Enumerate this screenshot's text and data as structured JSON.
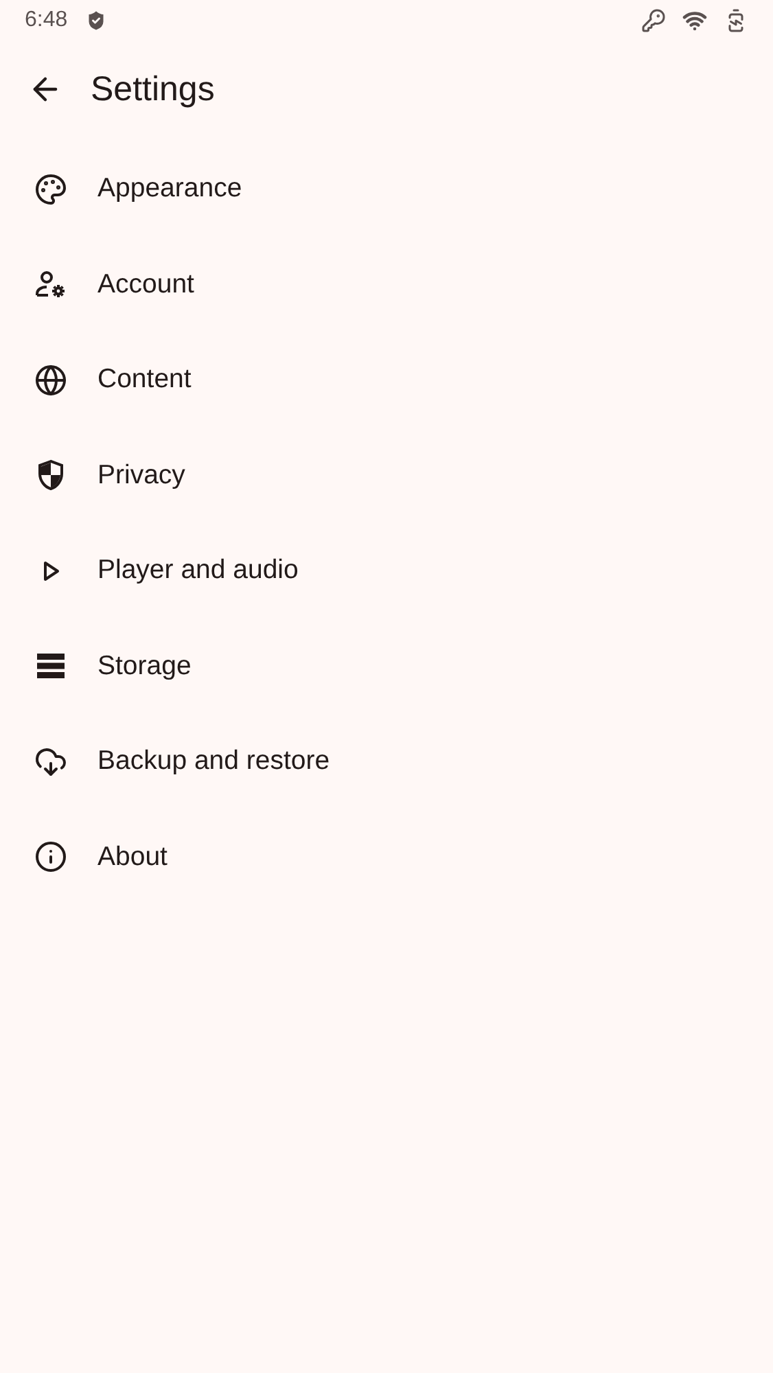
{
  "status_bar": {
    "time": "6:48"
  },
  "header": {
    "title": "Settings"
  },
  "items": [
    {
      "label": "Appearance",
      "kind": "palette"
    },
    {
      "label": "Account",
      "kind": "usergear"
    },
    {
      "label": "Content",
      "kind": "globe"
    },
    {
      "label": "Privacy",
      "kind": "shield"
    },
    {
      "label": "Player and audio",
      "kind": "play"
    },
    {
      "label": "Storage",
      "kind": "storage"
    },
    {
      "label": "Backup and restore",
      "kind": "cloud"
    },
    {
      "label": "About",
      "kind": "info"
    }
  ]
}
